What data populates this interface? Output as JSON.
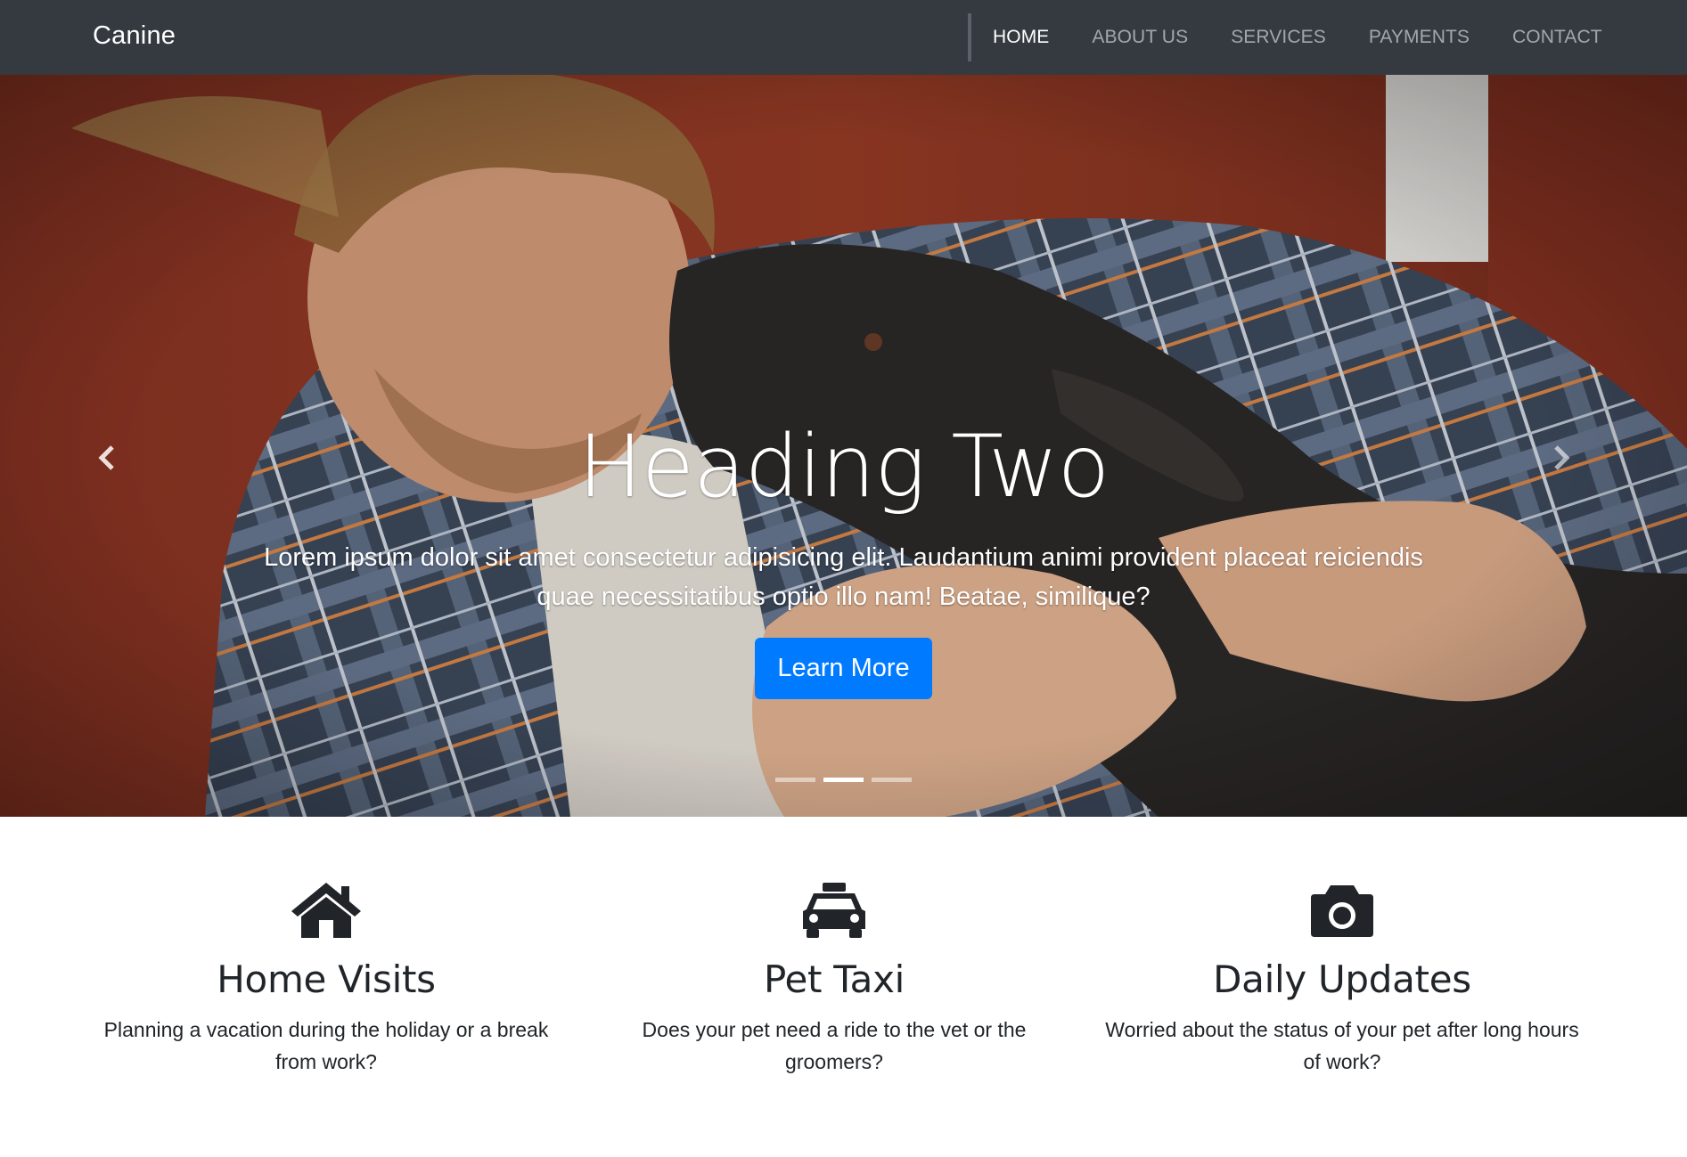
{
  "navbar": {
    "brand": "Canine",
    "links": [
      {
        "label": "HOME",
        "active": true
      },
      {
        "label": "ABOUT US",
        "active": false
      },
      {
        "label": "SERVICES",
        "active": false
      },
      {
        "label": "PAYMENTS",
        "active": false
      },
      {
        "label": "CONTACT",
        "active": false
      }
    ]
  },
  "hero": {
    "heading": "Heading Two",
    "text": "Lorem ipsum dolor sit amet consectetur adipisicing elit. Laudantium animi provident placeat reiciendis quae necessitatibus optio illo nam! Beatae, similique?",
    "button_label": "Learn More",
    "prev_icon": "chevron-left-icon",
    "next_icon": "chevron-right-icon",
    "slide_count": 3,
    "active_slide": 2
  },
  "features": [
    {
      "icon": "home-icon",
      "title": "Home Visits",
      "text": "Planning a vacation during the holiday or a break from work?"
    },
    {
      "icon": "taxi-icon",
      "title": "Pet Taxi",
      "text": "Does your pet need a ride to the vet or the groomers?"
    },
    {
      "icon": "camera-icon",
      "title": "Daily Updates",
      "text": "Worried about the status of your pet after long hours of work?"
    }
  ],
  "colors": {
    "navbar_bg": "#343a40",
    "primary": "#007bff",
    "hero_wall": "#8c3624"
  }
}
